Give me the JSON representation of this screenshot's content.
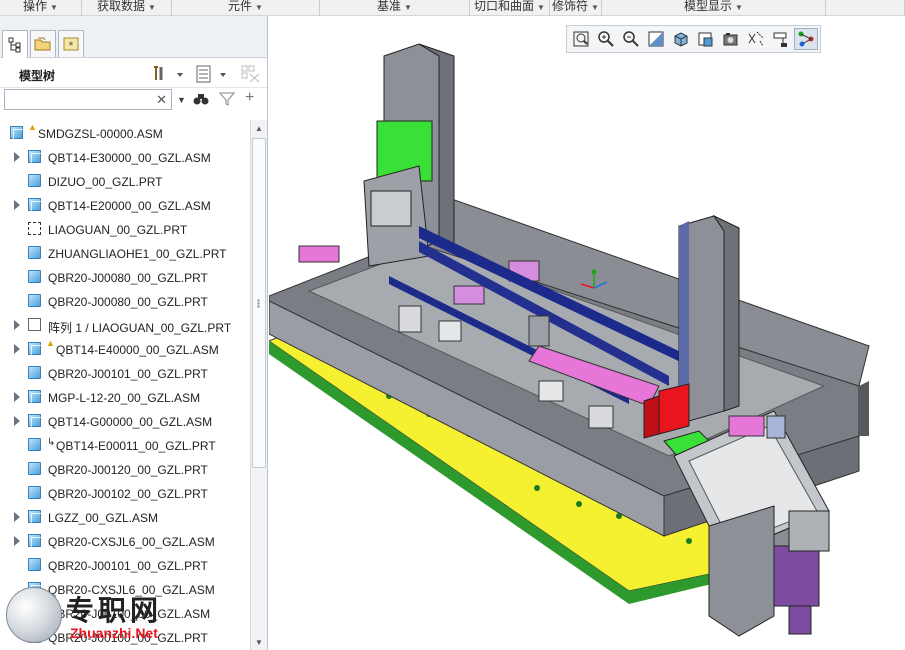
{
  "ribbon": {
    "groups": [
      {
        "label": "操作",
        "width": 82
      },
      {
        "label": "获取数据",
        "width": 90
      },
      {
        "label": "元件",
        "width": 148
      },
      {
        "label": "基准",
        "width": 150
      },
      {
        "label": "切口和曲面",
        "width": 80
      },
      {
        "label": "修饰符",
        "width": 52
      },
      {
        "label": "模型显示",
        "width": 224
      },
      {
        "label": "",
        "width": 79
      }
    ]
  },
  "panel": {
    "title": "模型树",
    "search": {
      "value": "",
      "placeholder": ""
    }
  },
  "tree": {
    "items": [
      {
        "label": "SMDGZSL-00000.ASM",
        "expander": false,
        "icon": "asm",
        "warn": true,
        "indent": 0
      },
      {
        "label": "QBT14-E30000_00_GZL.ASM",
        "expander": true,
        "icon": "asm",
        "warn": false,
        "indent": 1
      },
      {
        "label": "DIZUO_00_GZL.PRT",
        "expander": false,
        "icon": "part",
        "warn": false,
        "indent": 1
      },
      {
        "label": "QBT14-E20000_00_GZL.ASM",
        "expander": true,
        "icon": "asm",
        "warn": false,
        "indent": 1
      },
      {
        "label": "LIAOGUAN_00_GZL.PRT",
        "expander": false,
        "icon": "sk",
        "warn": false,
        "indent": 1
      },
      {
        "label": "ZHUANGLIAOHE1_00_GZL.PRT",
        "expander": false,
        "icon": "part",
        "warn": false,
        "indent": 1
      },
      {
        "label": "QBR20-J00080_00_GZL.PRT",
        "expander": false,
        "icon": "part",
        "warn": false,
        "indent": 1
      },
      {
        "label": "QBR20-J00080_00_GZL.PRT",
        "expander": false,
        "icon": "part",
        "warn": false,
        "indent": 1
      },
      {
        "label": "阵列 1 / LIAOGUAN_00_GZL.PRT",
        "expander": true,
        "icon": "pat",
        "warn": false,
        "indent": 1
      },
      {
        "label": "QBT14-E40000_00_GZL.ASM",
        "expander": true,
        "icon": "asm",
        "warn": true,
        "indent": 1
      },
      {
        "label": "QBR20-J00101_00_GZL.PRT",
        "expander": false,
        "icon": "part",
        "warn": false,
        "indent": 1
      },
      {
        "label": "MGP-L-12-20_00_GZL.ASM",
        "expander": true,
        "icon": "asm",
        "warn": false,
        "indent": 1
      },
      {
        "label": "QBT14-G00000_00_GZL.ASM",
        "expander": true,
        "icon": "asm",
        "warn": false,
        "indent": 1
      },
      {
        "label": "QBT14-E00011_00_GZL.PRT",
        "expander": false,
        "icon": "part",
        "warn": false,
        "indent": 1,
        "flag": true
      },
      {
        "label": "QBR20-J00120_00_GZL.PRT",
        "expander": false,
        "icon": "part",
        "warn": false,
        "indent": 1
      },
      {
        "label": "QBR20-J00102_00_GZL.PRT",
        "expander": false,
        "icon": "part",
        "warn": false,
        "indent": 1
      },
      {
        "label": "LGZZ_00_GZL.ASM",
        "expander": true,
        "icon": "asm",
        "warn": false,
        "indent": 1
      },
      {
        "label": "QBR20-CXSJL6_00_GZL.ASM",
        "expander": true,
        "icon": "asm",
        "warn": false,
        "indent": 1
      },
      {
        "label": "QBR20-J00101_00_GZL.PRT",
        "expander": false,
        "icon": "part",
        "warn": false,
        "indent": 1
      },
      {
        "label": "QBR20-CXSJL6_00_GZL.ASM",
        "expander": false,
        "icon": "asm",
        "warn": false,
        "indent": 1
      },
      {
        "label": "QBR20-J00100_00_GZL.ASM",
        "expander": false,
        "icon": "asm",
        "warn": false,
        "indent": 1
      },
      {
        "label": "QBR20-J00100_00_GZL.PRT",
        "expander": false,
        "icon": "part",
        "warn": false,
        "indent": 1
      }
    ]
  },
  "viewport_toolbar": {
    "buttons": [
      {
        "name": "refit-icon"
      },
      {
        "name": "zoom-in-icon"
      },
      {
        "name": "zoom-out-icon"
      },
      {
        "name": "repaint-icon"
      },
      {
        "name": "display-style-icon"
      },
      {
        "name": "saved-orientations-icon"
      },
      {
        "name": "view-manager-icon"
      },
      {
        "name": "datum-display-icon"
      },
      {
        "name": "annotation-display-icon"
      },
      {
        "name": "spin-center-icon",
        "active": true
      }
    ]
  },
  "watermark": {
    "cn": "专职网",
    "en": "Zhuanzhi.Net"
  },
  "colors": {
    "accent_green": "#38e038",
    "accent_yellow": "#f5f030",
    "accent_magenta": "#e676d8",
    "accent_blue": "#1c2a8c",
    "accent_red": "#e8141e",
    "metal": "#8c9096"
  }
}
